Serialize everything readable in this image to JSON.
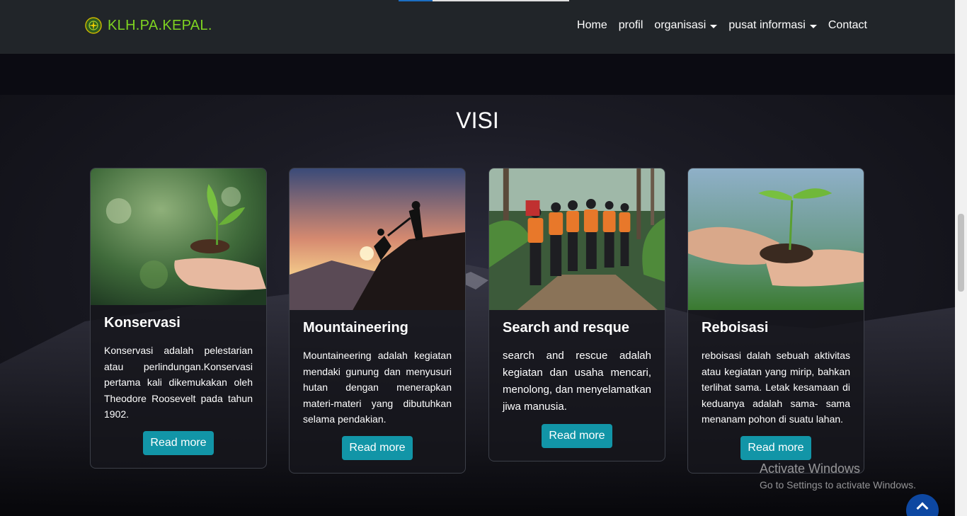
{
  "navbar": {
    "brand": "KLH.PA.KEPAL.",
    "links": [
      {
        "label": "Home"
      },
      {
        "label": "profil"
      },
      {
        "label": "organisasi"
      },
      {
        "label": "pusat informasi"
      },
      {
        "label": "Contact"
      }
    ]
  },
  "section": {
    "title": "VISI"
  },
  "cards": [
    {
      "title": "Konservasi",
      "text": "Konservasi adalah pelestarian atau perlindungan.Konservasi pertama kali dikemukakan oleh Theodore Roosevelt pada tahun 1902.",
      "button": "Read more"
    },
    {
      "title": "Mountaineering",
      "text": "Mountaineering adalah kegiatan mendaki gunung dan menyusuri hutan dengan menerapkan materi-materi yang dibutuhkan selama pendakian.",
      "button": "Read more"
    },
    {
      "title": "Search and resque",
      "text": "search and rescue adalah kegiatan dan usaha mencari, menolong, dan menyelamatkan jiwa manusia.",
      "button": "Read more"
    },
    {
      "title": "Reboisasi",
      "text": "reboisasi dalah sebuah aktivitas atau kegiatan yang mirip, bahkan terlihat sama. Letak kesamaan di keduanya adalah sama- sama menanam pohon di suatu lahan.",
      "button": "Read more"
    }
  ],
  "watermark": {
    "line1": "Activate Windows",
    "line2": "Go to Settings to activate Windows."
  },
  "colors": {
    "brand": "#7ed321",
    "navbar": "#212529",
    "button": "#1295a7",
    "back_to_top": "#0d47a1"
  }
}
